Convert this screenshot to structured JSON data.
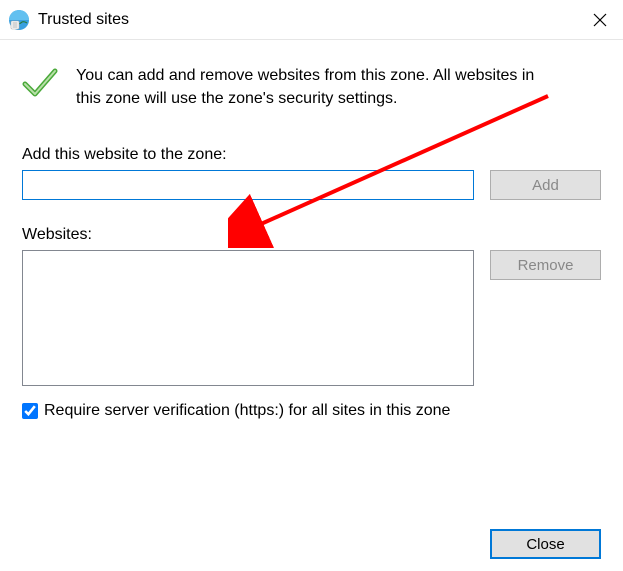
{
  "dialog": {
    "title": "Trusted sites"
  },
  "info": {
    "text": "You can add and remove websites from this zone. All websites in this zone will use the zone's security settings."
  },
  "addSection": {
    "label": "Add this website to the zone:",
    "inputValue": "",
    "addButton": "Add"
  },
  "websitesSection": {
    "label": "Websites:",
    "removeButton": "Remove"
  },
  "requireHttps": {
    "label": "Require server verification (https:) for all sites in this zone",
    "checked": true
  },
  "footer": {
    "closeButton": "Close"
  }
}
